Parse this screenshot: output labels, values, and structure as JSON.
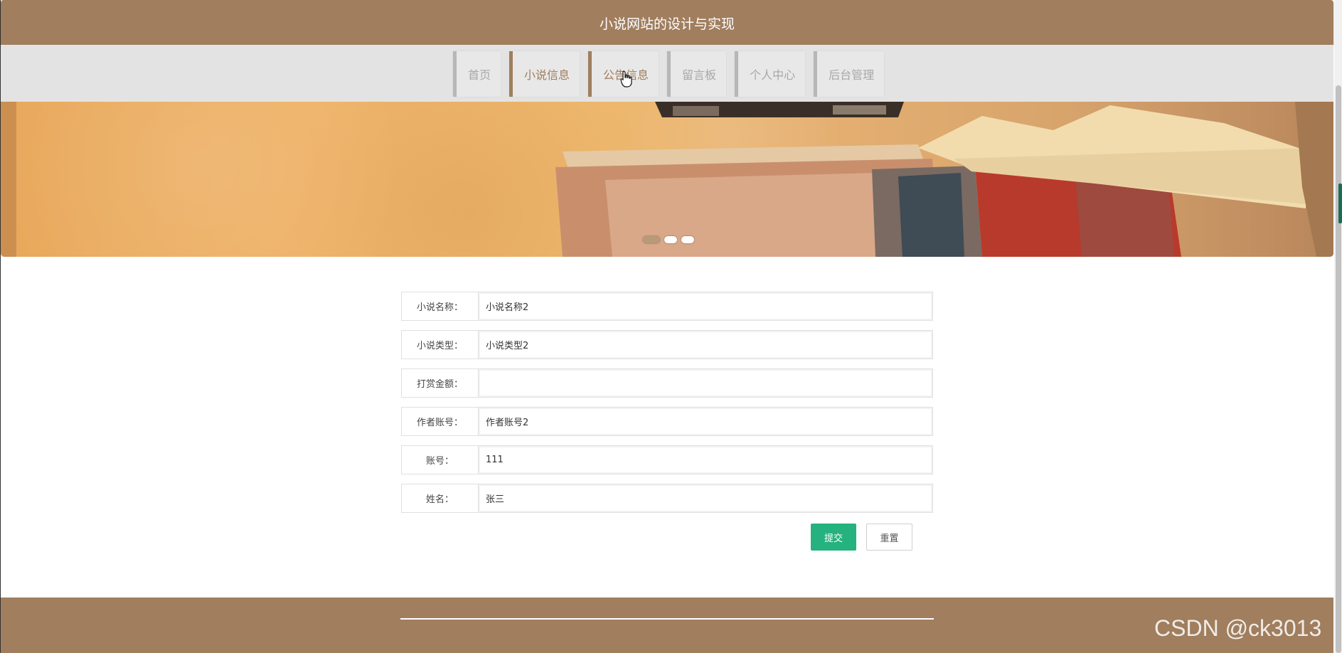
{
  "header": {
    "title": "小说网站的设计与实现"
  },
  "nav": {
    "items": [
      {
        "label": "首页",
        "active": false
      },
      {
        "label": "小说信息",
        "active": true
      },
      {
        "label": "公告信息",
        "active": true
      },
      {
        "label": "留言板",
        "active": false
      },
      {
        "label": "个人中心",
        "active": false
      },
      {
        "label": "后台管理",
        "active": false
      }
    ]
  },
  "banner": {
    "slide_count": 3,
    "active_slide": 1
  },
  "form": {
    "fields": [
      {
        "label": "小说名称：",
        "value": "小说名称2"
      },
      {
        "label": "小说类型：",
        "value": "小说类型2"
      },
      {
        "label": "打赏金额：",
        "value": ""
      },
      {
        "label": "作者账号：",
        "value": "作者账号2"
      },
      {
        "label": "账号：",
        "value": "111"
      },
      {
        "label": "姓名：",
        "value": "张三"
      }
    ],
    "submit_label": "提交",
    "reset_label": "重置"
  },
  "watermark": "CSDN @ck3013",
  "colors": {
    "brand": "#a07e5e",
    "submit": "#25b27e",
    "nav_bg": "#e3e3e3"
  }
}
